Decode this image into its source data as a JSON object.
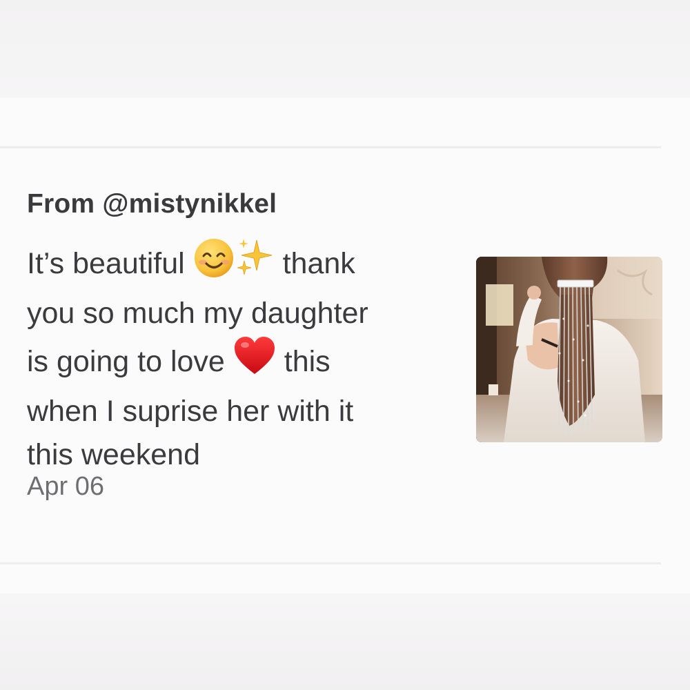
{
  "review": {
    "sender": "From @mistynikkel",
    "message": {
      "line1_before": "It’s beautiful",
      "line1_emoji1": "smiling-face-icon",
      "line1_emoji2": "sparkles-icon",
      "line1_after": "thank",
      "line2": "you so much my daughter",
      "line3_before": "is going to love",
      "line3_emoji": "red-heart-icon",
      "line3_after": "this",
      "line4": "when I suprise her with it",
      "line5": "this weekend"
    },
    "date": "Apr 06",
    "photo": "product-photo"
  },
  "colors": {
    "background": "#f2f1f2",
    "card": "#fcfbfc",
    "text": "#3b3b3d",
    "date_text": "#6e6e72",
    "heart": "#e0141e",
    "smiley": "#f7b92e"
  }
}
